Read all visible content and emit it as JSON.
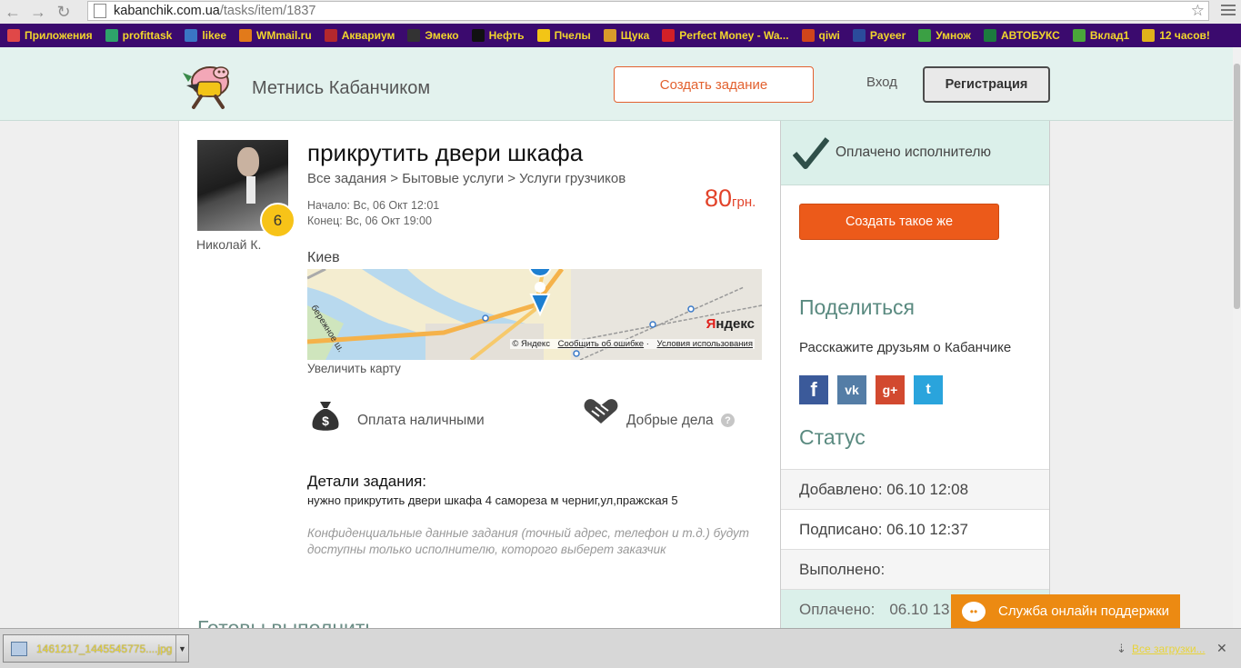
{
  "browser": {
    "url_host": "kabanchik.com.ua",
    "url_path": "/tasks/item/1837",
    "bookmarks": [
      "Приложения",
      "profittask",
      "likee",
      "WMmail.ru",
      "Аквариум",
      "Эмеко",
      "Нефть",
      "Пчелы",
      "Щука",
      "Perfect Money - Wa...",
      "qiwi",
      "Payeer",
      "Умнож",
      "АВТОБУКС",
      "Вклад1",
      "12 часов!"
    ],
    "bookmark_colors": [
      "#e04848",
      "#2ea36a",
      "#3a76c4",
      "#e27a1a",
      "#b3282d",
      "#333333",
      "#111111",
      "#f2c516",
      "#d99b2b",
      "#d32027",
      "#d0451b",
      "#2b4b9b",
      "#3ba044",
      "#1c7a3e",
      "#4aa63a",
      "#e0b21a"
    ]
  },
  "header": {
    "site_name": "Метнись Кабанчиком",
    "create_task": "Создать задание",
    "login": "Вход",
    "register": "Регистрация"
  },
  "task": {
    "author": "Николай К.",
    "rating": "6",
    "title": "прикрутить двери шкафа",
    "breadcrumb": "Все задания > Бытовые услуги > Услуги грузчиков",
    "start": "Начало: Вс, 06 Окт 12:01",
    "end": "Конец: Вс, 06 Окт 19:00",
    "price": "80",
    "currency": "грн.",
    "city": "Киев",
    "map_street": "бережное ш.",
    "map_credit": "© Яндекс",
    "map_report": "Сообщить об ошибке",
    "map_terms": "Условия использования",
    "map_brand_y": "Я",
    "map_brand_rest": "ндекс",
    "zoom_map": "Увеличить карту",
    "payment": "Оплата наличными",
    "good_deeds": "Добрые дела",
    "details_head": "Детали задания:",
    "details_text": "нужно прикрутить двери шкафа 4 самореза м черниг,ул,пражская 5",
    "privacy_note": "Конфиденциальные данные задания (точный адрес, телефон и т.д.) будут доступны только исполнителю, которого выберет заказчик",
    "ready_head": "Готовы выполнить"
  },
  "sidebar": {
    "paid": "Оплачено исполнителю",
    "create_same": "Создать такое же",
    "share_head": "Поделиться",
    "share_text": "Расскажите друзьям о Кабанчике",
    "status_head": "Статус",
    "added": "Добавлено: 06.10 12:08",
    "signed": "Подписано: 06.10 12:37",
    "done": "Выполнено:",
    "paid_label": "Оплачено:",
    "paid_value": "06.10 13"
  },
  "support": "Служба онлайн поддержки",
  "downloads": {
    "file": "1461217_1445545775....jpg",
    "all": "Все загрузки..."
  },
  "colors": {
    "accent": "#ec5a1a",
    "header_bg": "#e3f2ee",
    "price": "#e2432a",
    "bookmarks_bg": "#3b0a6e"
  }
}
